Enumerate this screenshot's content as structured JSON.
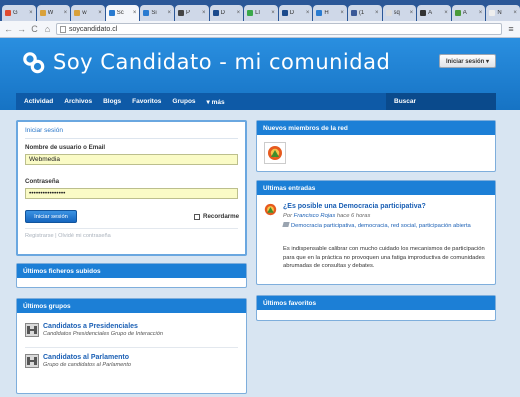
{
  "browser": {
    "tabs": [
      {
        "label": "G",
        "color": "#e04b2f",
        "active": false
      },
      {
        "label": "W",
        "color": "#d9a13a",
        "active": false
      },
      {
        "label": "w",
        "color": "#d9a13a",
        "active": false
      },
      {
        "label": "Sc",
        "color": "#2a7bd0",
        "active": true
      },
      {
        "label": "Si",
        "color": "#2a7bd0",
        "active": false
      },
      {
        "label": "P",
        "color": "#444444",
        "active": false
      },
      {
        "label": "D",
        "color": "#1b4a8c",
        "active": false
      },
      {
        "label": "Ll",
        "color": "#3aa84a",
        "active": false
      },
      {
        "label": "D",
        "color": "#1b4a8c",
        "active": false
      },
      {
        "label": "H",
        "color": "#2a7bd0",
        "active": false
      },
      {
        "label": "(1",
        "color": "#3b5998",
        "active": false
      },
      {
        "label": "sq",
        "color": "#dddddd",
        "active": false
      },
      {
        "label": "A",
        "color": "#333333",
        "active": false
      },
      {
        "label": "A",
        "color": "#4a9a3a",
        "active": false
      },
      {
        "label": "N",
        "color": "#eeeeee",
        "active": false
      }
    ],
    "close_glyph": "×",
    "url": "soycandidato.cl",
    "back_glyph": "←",
    "forward_glyph": "→",
    "reload_glyph": "C",
    "home_glyph": "⌂",
    "menu_glyph": "≡"
  },
  "header": {
    "title": "Soy Candidato - mi comunidad",
    "login_button": "Iniciar sesión ▾",
    "nav": [
      "Actividad",
      "Archivos",
      "Blogs",
      "Favoritos",
      "Grupos",
      "▾ más"
    ],
    "search_label": "Buscar"
  },
  "login": {
    "title": "Iniciar sesión",
    "username_label": "Nombre de usuario o Email",
    "username_value": "Webmedia",
    "password_label": "Contraseña",
    "password_value": "••••••••••••••••",
    "submit_label": "Iniciar sesión",
    "remember_label": "Recordarme",
    "links": "Registrarse  |  Olvidé mi contraseña"
  },
  "files": {
    "title": "Últimos ficheros subidos"
  },
  "groups": {
    "title": "Últimos grupos",
    "items": [
      {
        "name": "Candidatos a Presidenciales",
        "desc": "Candidatos Presidenciales Grupo de Interacción"
      },
      {
        "name": "Candidatos al Parlamento",
        "desc": "Grupo de candidatos al Parlamento"
      }
    ]
  },
  "members": {
    "title": "Nuevos miembros de la red"
  },
  "entries": {
    "title": "Ultimas entradas",
    "post_title": "¿Es posible una Democracia participativa?",
    "meta_prefix": "Por",
    "author": "Francisco Rojas",
    "time": "hace 6 horas",
    "tags": "Democracia participativa, democracia, red social, participación abierta",
    "body": "Es indispensable calibrar con mucho cuidado los mecanismos de participación para que en la práctica no provoquen una fatiga improductiva de comunidades abrumadas de consultas y debates."
  },
  "favorites": {
    "title": "Últimos favoritos"
  },
  "colors": {
    "header_blue": "#1c7fd6",
    "nav_blue": "#0e5aa7",
    "link_blue": "#1a5fb4",
    "field_yellow": "#fafbc6"
  }
}
